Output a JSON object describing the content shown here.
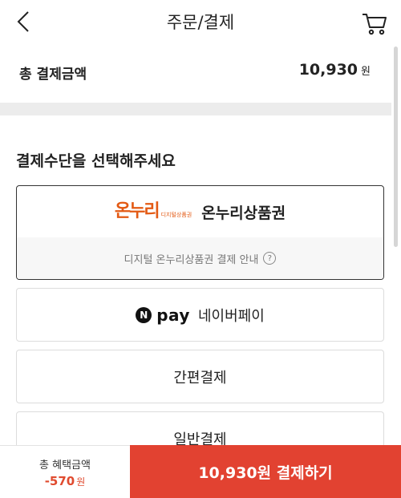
{
  "header": {
    "title": "주문/결제",
    "back_icon": "chevron-left-icon",
    "cart_icon": "cart-icon"
  },
  "order_total": {
    "label": "총 결제금액",
    "amount": "10,930",
    "unit": "원"
  },
  "payment_section": {
    "title": "결제수단을 선택해주세요",
    "options": {
      "onnuri": {
        "logo_text": "온누리",
        "logo_subtext": "디지털상품권",
        "label": "온누리상품권",
        "info_text": "디지털 온누리상품권 결제 안내",
        "info_icon": "?"
      },
      "npay": {
        "logo_letter": "N",
        "logo_word": "pay",
        "label": "네이버페이"
      },
      "simple": {
        "label": "간편결제"
      },
      "general": {
        "label": "일반결제"
      }
    }
  },
  "bottom_bar": {
    "benefit_label": "총 혜택금액",
    "benefit_amount": "-570",
    "benefit_unit": "원",
    "pay_button_label": "10,930원 결제하기"
  },
  "colors": {
    "accent": "#e24231",
    "benefit": "#e04b2f",
    "onnuri_brand": "#e35a14"
  }
}
